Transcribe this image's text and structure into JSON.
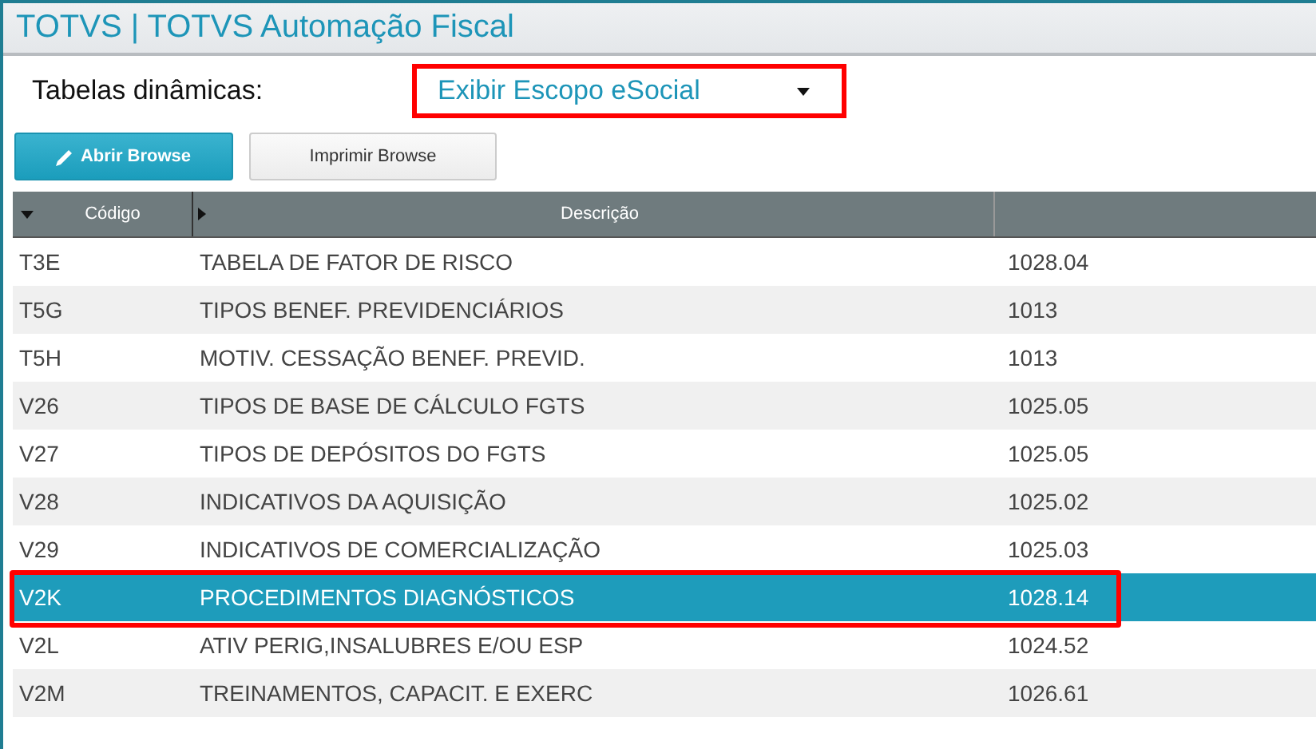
{
  "window": {
    "title": "TOTVS | TOTVS Automação Fiscal"
  },
  "filter": {
    "label": "Tabelas dinâmicas:",
    "value": "Exibir Escopo eSocial",
    "highlighted": true
  },
  "buttons": [
    {
      "label": "Abrir Browse",
      "kind": "primary"
    },
    {
      "label": "Imprimir Browse",
      "kind": "secondary"
    }
  ],
  "table": {
    "columns": [
      "Código",
      "Descrição"
    ],
    "rows": [
      {
        "code": "T3E",
        "description": "TABELA DE FATOR DE RISCO",
        "version": "1028.04",
        "selected": false,
        "highlighted": false
      },
      {
        "code": "T5G",
        "description": "TIPOS BENEF. PREVIDENCIÁRIOS",
        "version": "1013",
        "selected": false,
        "highlighted": false
      },
      {
        "code": "T5H",
        "description": "MOTIV. CESSAÇÃO BENEF. PREVID.",
        "version": "1013",
        "selected": false,
        "highlighted": false
      },
      {
        "code": "V26",
        "description": "TIPOS DE BASE DE CÁLCULO FGTS",
        "version": "1025.05",
        "selected": false,
        "highlighted": false
      },
      {
        "code": "V27",
        "description": "TIPOS DE DEPÓSITOS DO FGTS",
        "version": "1025.05",
        "selected": false,
        "highlighted": false
      },
      {
        "code": "V28",
        "description": "INDICATIVOS DA AQUISIÇÃO",
        "version": "1025.02",
        "selected": false,
        "highlighted": false
      },
      {
        "code": "V29",
        "description": "INDICATIVOS DE COMERCIALIZAÇÃO",
        "version": "1025.03",
        "selected": false,
        "highlighted": false
      },
      {
        "code": "V2K",
        "description": "PROCEDIMENTOS DIAGNÓSTICOS",
        "version": "1028.14",
        "selected": true,
        "highlighted": true
      },
      {
        "code": "V2L",
        "description": "ATIV PERIG,INSALUBRES E/OU ESP",
        "version": "1024.52",
        "selected": false,
        "highlighted": false
      },
      {
        "code": "V2M",
        "description": "TREINAMENTOS, CAPACIT. E EXERC",
        "version": "1026.61",
        "selected": false,
        "highlighted": false
      }
    ]
  }
}
